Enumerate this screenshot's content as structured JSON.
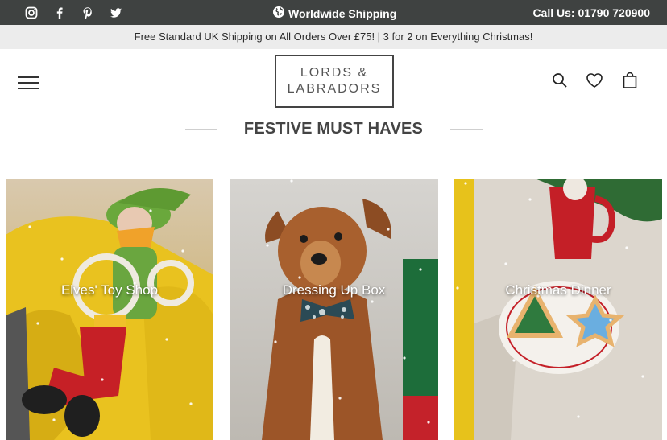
{
  "topbar": {
    "shipping_text": "Worldwide Shipping",
    "phone_text": "Call Us: 01790 720900",
    "social": [
      "instagram-icon",
      "facebook-icon",
      "pinterest-icon",
      "twitter-icon"
    ]
  },
  "promo": {
    "text": "Free Standard UK Shipping on All Orders Over £75! | 3 for 2 on Everything Christmas!"
  },
  "header": {
    "logo_line1": "LORDS &",
    "logo_line2": "LABRADORS",
    "icons": [
      "menu-icon",
      "search-icon",
      "heart-icon",
      "bag-icon"
    ]
  },
  "section": {
    "title": "FESTIVE MUST HAVES"
  },
  "tiles": [
    {
      "label": "Elves' Toy Shop"
    },
    {
      "label": "Dressing Up Box"
    },
    {
      "label": "Christmas Dinner"
    }
  ],
  "colors": {
    "topbar_bg": "#3f4241",
    "promo_bg": "#ececec",
    "text_dark": "#444444"
  }
}
